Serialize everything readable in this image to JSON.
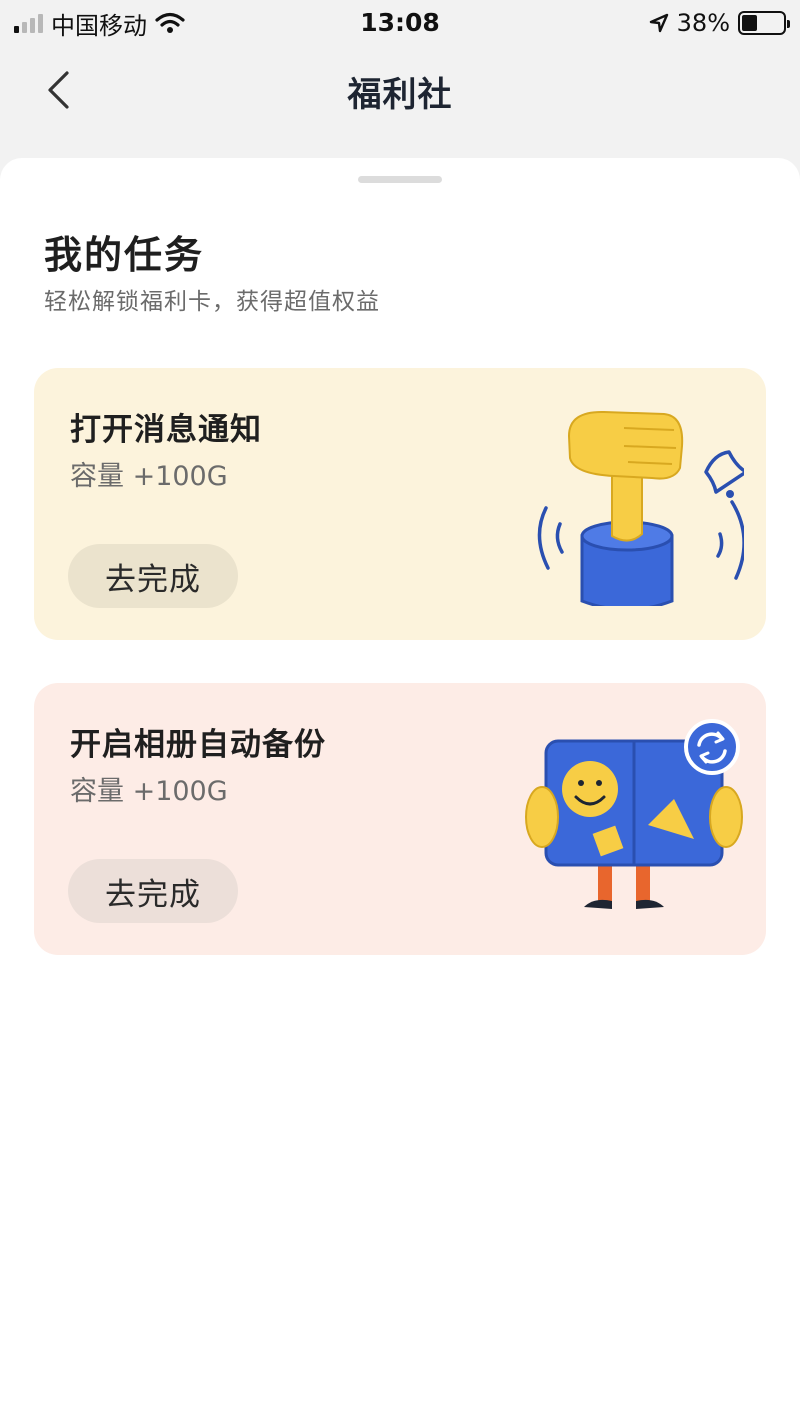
{
  "status_bar": {
    "carrier": "中国移动",
    "time": "13:08",
    "battery_percent": "38%",
    "battery_level": 0.38,
    "signal_bars_active": 1,
    "signal_bars_total": 4,
    "icons": [
      "signal-icon",
      "wifi-icon",
      "location-arrow-icon",
      "battery-icon"
    ]
  },
  "nav": {
    "title": "福利社",
    "back_icon": "chevron-left-icon"
  },
  "section": {
    "title": "我的任务",
    "subtitle": "轻松解锁福利卡，获得超值权益"
  },
  "tasks": [
    {
      "title": "打开消息通知",
      "reward": "容量 +100G",
      "button_label": "去完成",
      "illustration": "hand-pressing-bell-button",
      "background": "#fcf3dc"
    },
    {
      "title": "开启相册自动备份",
      "reward": "容量 +100G",
      "button_label": "去完成",
      "illustration": "person-holding-photo-album-sync",
      "background": "#fdece6"
    }
  ],
  "colors": {
    "accent_blue": "#3b68d9",
    "illustration_yellow": "#f7cd45",
    "illustration_orange": "#e8662d",
    "title_dark": "#1e2532"
  }
}
